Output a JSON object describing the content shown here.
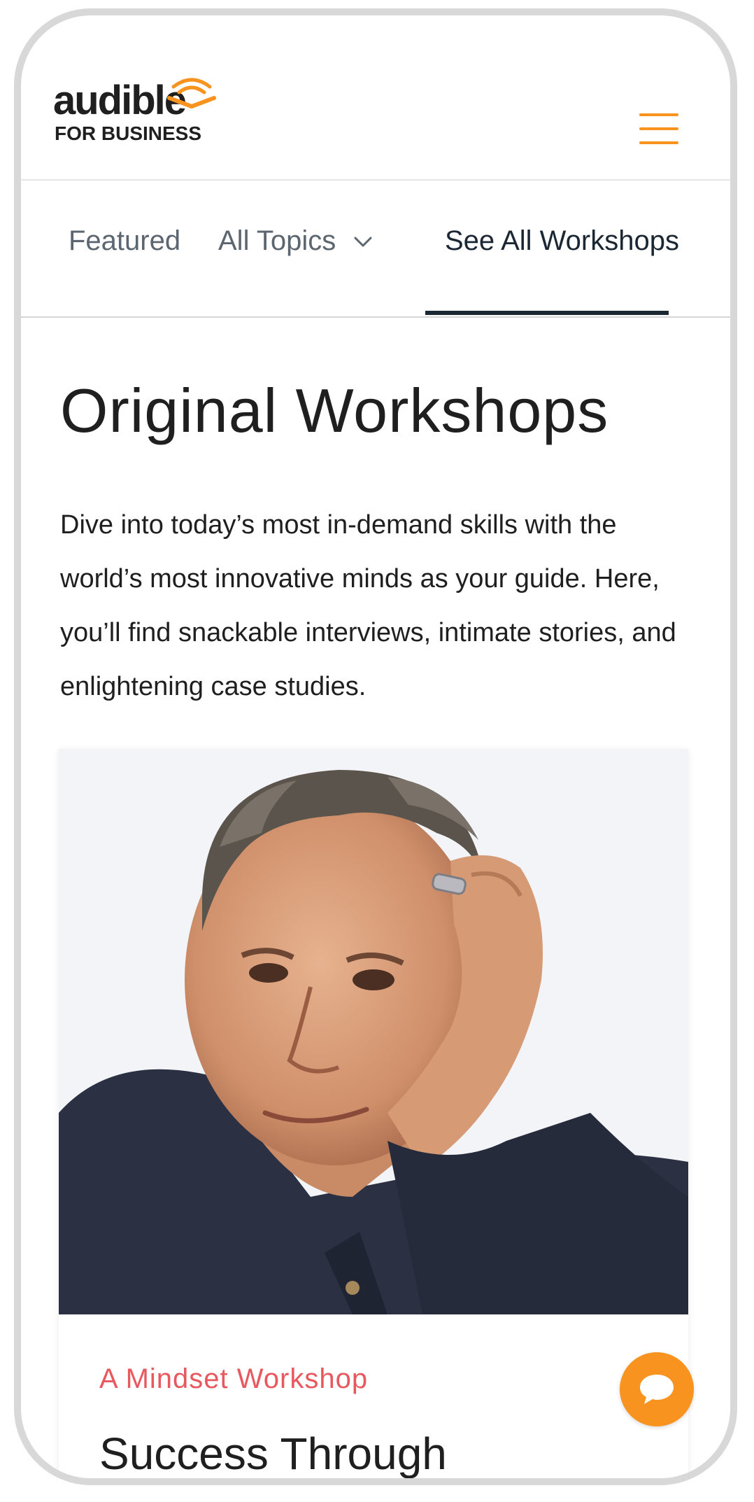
{
  "brand": {
    "logo_word": "audible",
    "logo_sub": "FOR BUSINESS",
    "accent_color": "#f7931e"
  },
  "header": {
    "menu_icon": "hamburger-menu-icon"
  },
  "tabs": [
    {
      "label": "Featured",
      "active": false
    },
    {
      "label": "All Topics",
      "active": false,
      "icon": "chevron-down-icon"
    },
    {
      "label": "See All Workshops",
      "active": true
    }
  ],
  "main": {
    "title": "Original Workshops",
    "intro": "Dive into today’s most in-demand skills with the world’s most innovative minds as your guide. Here, you’ll find snackable interviews, intimate stories, and enlightening case  studies."
  },
  "card": {
    "eyebrow": "A Mindset Workshop",
    "eyebrow_color": "#e8595f",
    "title": "Success Through"
  },
  "chat": {
    "icon": "chat-bubble-icon"
  }
}
